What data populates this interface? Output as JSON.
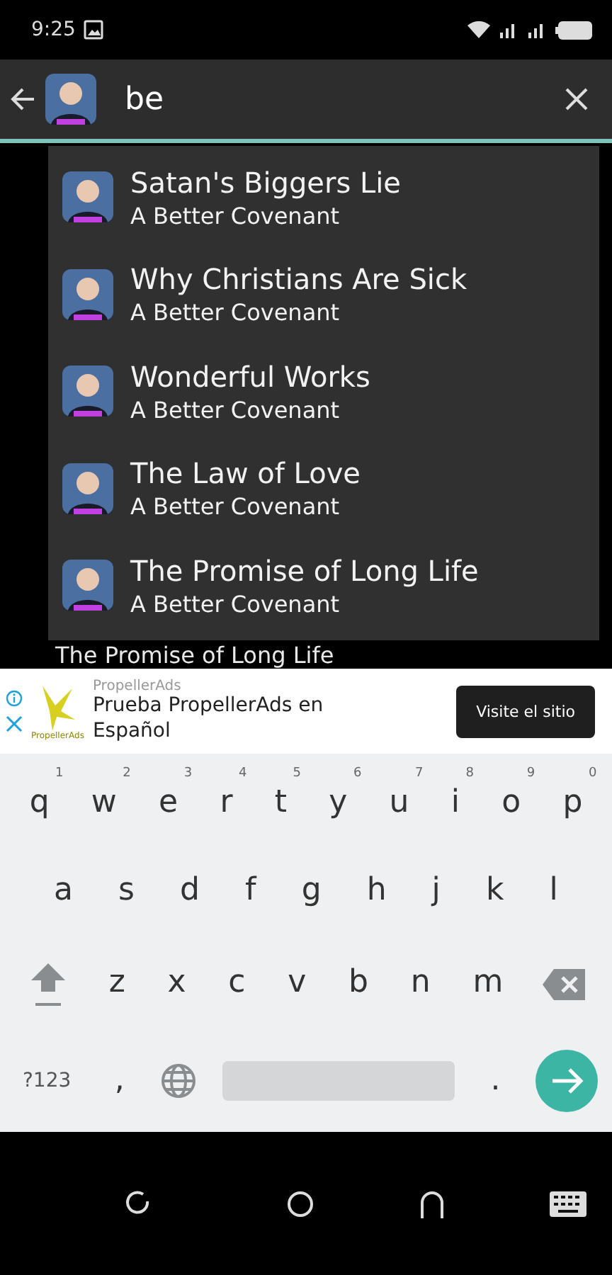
{
  "status_bar": {
    "time": "9:25"
  },
  "search": {
    "value": "be"
  },
  "suggestions": [
    {
      "title": "Satan's Biggers Lie",
      "subtitle": "A Better Covenant"
    },
    {
      "title": "Why Christians Are Sick",
      "subtitle": "A Better Covenant"
    },
    {
      "title": "Wonderful Works",
      "subtitle": "A Better Covenant"
    },
    {
      "title": "The Law of Love",
      "subtitle": "A Better Covenant"
    },
    {
      "title": "The Promise of Long Life",
      "subtitle": "A Better Covenant"
    }
  ],
  "background_list": [
    "The Promise of Long Life"
  ],
  "ad": {
    "brand": "PropellerAds",
    "logo_text": "PropellerAds",
    "headline": "Prueba PropellerAds en Español",
    "button": "Visite el sitio"
  },
  "keyboard": {
    "rows": [
      [
        {
          "key": "q",
          "hint": "1"
        },
        {
          "key": "w",
          "hint": "2"
        },
        {
          "key": "e",
          "hint": "3"
        },
        {
          "key": "r",
          "hint": "4"
        },
        {
          "key": "t",
          "hint": "5"
        },
        {
          "key": "y",
          "hint": "6"
        },
        {
          "key": "u",
          "hint": "7"
        },
        {
          "key": "i",
          "hint": "8"
        },
        {
          "key": "o",
          "hint": "9"
        },
        {
          "key": "p",
          "hint": "0"
        }
      ],
      [
        {
          "key": "a"
        },
        {
          "key": "s"
        },
        {
          "key": "d"
        },
        {
          "key": "f"
        },
        {
          "key": "g"
        },
        {
          "key": "h"
        },
        {
          "key": "j"
        },
        {
          "key": "k"
        },
        {
          "key": "l"
        }
      ],
      [
        {
          "key": "z"
        },
        {
          "key": "x"
        },
        {
          "key": "c"
        },
        {
          "key": "v"
        },
        {
          "key": "b"
        },
        {
          "key": "n"
        },
        {
          "key": "m"
        }
      ]
    ],
    "symbols": "?123",
    "comma": ",",
    "period": "."
  }
}
